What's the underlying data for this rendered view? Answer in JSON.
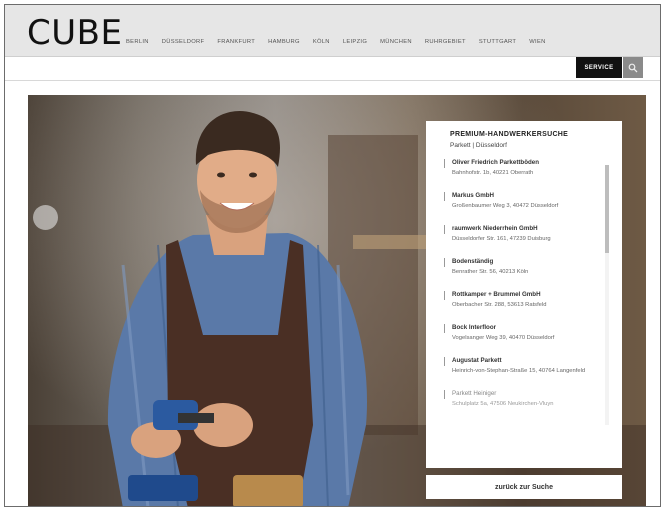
{
  "header": {
    "logo": "CUBE",
    "cities": [
      "BERLIN",
      "DÜSSELDORF",
      "FRANKFURT",
      "HAMBURG",
      "KÖLN",
      "LEIPZIG",
      "MÜNCHEN",
      "RUHRGEBIET",
      "STUTTGART",
      "WIEN"
    ]
  },
  "toolbar": {
    "service_label": "SERVICE",
    "search_icon": "search-icon"
  },
  "panel": {
    "title": "PREMIUM-HANDWERKERSUCHE",
    "subtitle": "Parkett | Düsseldorf",
    "items": [
      {
        "name": "Oliver Friedrich Parkettböden",
        "address": "Bahnhofstr. 1b, 40221 Oberrath"
      },
      {
        "name": "Markus GmbH",
        "address": "Großenbaumer Weg 3, 40472 Düsseldorf"
      },
      {
        "name": "raumwerk Niederrhein GmbH",
        "address": "Düsseldorfer Str. 161, 47239 Duisburg"
      },
      {
        "name": "Bodenständig",
        "address": "Benrather Str. 56, 40213 Köln"
      },
      {
        "name": "Rottkamper + Brummel GmbH",
        "address": "Oberbacher Str. 288, 53613 Ratsfeld"
      },
      {
        "name": "Bock Interfloor",
        "address": "Vogelsanger Weg 39, 40470 Düsseldorf"
      },
      {
        "name": "Augustat Parkett",
        "address": "Heinrich-von-Stephan-Straße 15, 40764 Langenfeld"
      },
      {
        "name": "Parkett Heiniger",
        "address": "Schulplatz 5a, 47506 Neukirchen-Vluyn"
      }
    ],
    "back_label": "zurück zur Suche"
  }
}
